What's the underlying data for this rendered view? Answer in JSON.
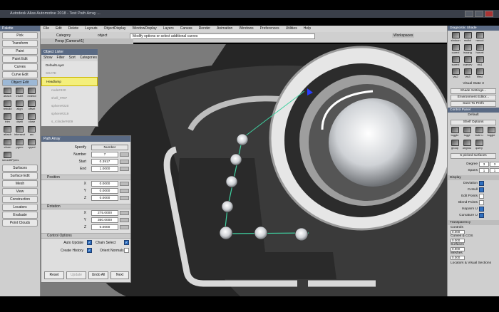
{
  "window": {
    "title": "Autodesk Alias Automotive 2018 - Test Path Array ..."
  },
  "menubar": [
    "File",
    "Edit",
    "Delete",
    "Layouts",
    "ObjectDisplay",
    "WindowDisplay",
    "Layers",
    "Canvas",
    "Render",
    "Animation",
    "Windows",
    "Preferences",
    "Utilities",
    "Help"
  ],
  "toolrow": {
    "category_label": "Category",
    "category_value": "object",
    "workspaces": "Workspaces",
    "hint": "Modify options or select additional curves",
    "view": "Persp [Camera#1]"
  },
  "palette": {
    "title": "Palette",
    "buttons": [
      "Pick",
      "Transform",
      "Paint",
      "Paint Edit",
      "Curves",
      "Curve Edit",
      "Object Edit"
    ],
    "active": "Object Edit",
    "icons": [
      [
        "attach",
        "insert",
        "extend"
      ],
      [
        "rebuild",
        "align",
        "offset"
      ],
      [
        "trim",
        "dwdt",
        "close"
      ],
      [
        "attach",
        "intersect",
        "arc"
      ],
      [
        "xform",
        "pgrec",
        "qryed"
      ],
      [
        "smoothPpms",
        "",
        ""
      ]
    ],
    "buttons2": [
      "Surfaces",
      "Surface Edit",
      "Mesh",
      "View",
      "Construction",
      "Locators",
      "Evaluate",
      "Point Clouds"
    ]
  },
  "object_lister": {
    "title": "Object Lister",
    "tabs": [
      "Show",
      "Filter",
      "Sort",
      "Categories"
    ],
    "items": [
      {
        "label": "DefaultLayer",
        "style": "normal"
      },
      {
        "label": "SDATE",
        "style": "dim"
      },
      {
        "label": "Headlamp",
        "style": "hl"
      },
      {
        "label": "node#420",
        "style": "dim"
      },
      {
        "label": "shell_##87",
        "style": "dim"
      },
      {
        "label": "sphere#220",
        "style": "dim"
      },
      {
        "label": "sphere#219",
        "style": "dim"
      },
      {
        "label": "s_rclinder#609",
        "style": "dim"
      }
    ]
  },
  "path_array": {
    "title": "Path Array",
    "specify_label": "Specify",
    "specify_value": "Number",
    "number_label": "Number",
    "number_value": "7",
    "start_label": "Start",
    "start_value": "0.3917",
    "end_label": "End",
    "end_value": "1.0000",
    "position_section": "Position",
    "position": [
      {
        "axis": "X",
        "value": "0.0000"
      },
      {
        "axis": "Y",
        "value": "0.0000"
      },
      {
        "axis": "Z",
        "value": "0.0000"
      }
    ],
    "rotation_section": "Rotation",
    "rotation": [
      {
        "axis": "X",
        "value": "275.0000"
      },
      {
        "axis": "Y",
        "value": "360.0000"
      },
      {
        "axis": "Z",
        "value": "0.0000"
      }
    ],
    "control_section": "Control Options",
    "auto_update": "Auto Update",
    "chain_select": "Chain Select",
    "create_history": "Create History",
    "orient_normals": "Orient Normals",
    "buttons": {
      "reset": "Reset",
      "update": "Update",
      "undo_all": "Undo All",
      "next": "Next"
    }
  },
  "right_panel": {
    "shade_title": "Diagnostic Shade",
    "shade_icons": [
      "shdoon",
      "multcl",
      "rancol",
      "curevl",
      "isoang",
      "horvel",
      "surevl",
      "cuevev",
      "vis1",
      "vis2",
      "vis3",
      "ffesl"
    ],
    "visual_state": "Visual State 3",
    "shade_settings": "Shade Settings...",
    "env_editor": "Environment Editor...",
    "save_prefs": "Save To Prefs",
    "control_panel": "Control Panel",
    "default": "Default",
    "shelf_options": "Shelf Options",
    "shelf_row": [
      "toggle",
      "toggl",
      "fade u",
      "toggle"
    ],
    "shelf_row2": [
      "group",
      "ungrou",
      "query"
    ],
    "selection": "5 picked surfaces",
    "degree_label": "Degree",
    "degree_u": "3",
    "degree_v": "3",
    "spans_label": "Spans",
    "spans_u": "1",
    "spans_v": "1",
    "display_section": "Display",
    "display": [
      {
        "label": "Deviation",
        "on": true
      },
      {
        "label": "CvHull",
        "on": true
      },
      {
        "label": "Edit Points",
        "on": false
      },
      {
        "label": "Blend Points",
        "on": false
      },
      {
        "label": "Isoparm U",
        "on": true
      },
      {
        "label": "Curvature U",
        "on": true
      }
    ],
    "transparency": "Transparency",
    "controls_label": "Controls",
    "controls_value": "0.000",
    "curves_cos_label": "Curves & COS",
    "curves_cos_value": "0.000",
    "surfaces_label": "Surfaces",
    "surfaces_value": "0.900",
    "meshes_label": "Meshes",
    "meshes_value": "0.000",
    "locators": "Locators & Visual Sections"
  }
}
